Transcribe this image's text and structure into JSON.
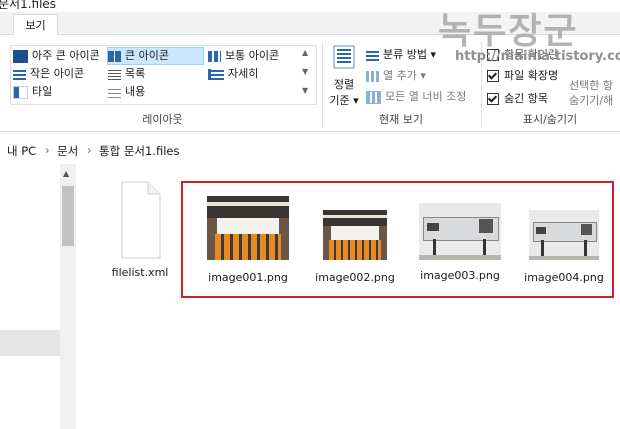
{
  "window": {
    "title": "문서1.files"
  },
  "ribbon": {
    "tab": "보기",
    "layout": {
      "items": [
        "아주 큰 아이콘",
        "큰 아이콘",
        "보통 아이콘",
        "작은 아이콘",
        "목록",
        "자세히",
        "타일",
        "내용"
      ],
      "selected": "큰 아이콘",
      "group_label": "레이아웃"
    },
    "current_view": {
      "sort_line1": "정렬",
      "sort_line2": "기준",
      "group_by": "분류 방법",
      "add_columns": "열 추가",
      "fit_columns": "모든 열 너비 조정",
      "group_label": "현재 보기"
    },
    "show_hide": {
      "item_checkboxes": "항목 확인란",
      "file_extensions": "파일 확장명",
      "hidden_items": "숨긴 항목",
      "hide_selected_line1": "선택한 항",
      "hide_selected_line2": "숨기기/해",
      "group_label": "표시/숨기기"
    }
  },
  "address": {
    "crumbs": [
      "내 PC",
      "문서",
      "통합 문서1.files"
    ],
    "separator": "›"
  },
  "files": [
    {
      "name": "filelist.xml",
      "icon": "document-icon"
    },
    {
      "name": "image001.png",
      "icon": "photo-thumbnail"
    },
    {
      "name": "image002.png",
      "icon": "photo-thumbnail"
    },
    {
      "name": "image003.png",
      "icon": "photo-thumbnail"
    },
    {
      "name": "image004.png",
      "icon": "photo-thumbnail"
    }
  ],
  "watermark": {
    "title": "녹두장군",
    "url": "http://mainia.tistory.com"
  },
  "colors": {
    "selection": "#cce8ff",
    "highlight_box": "#d0202a"
  }
}
